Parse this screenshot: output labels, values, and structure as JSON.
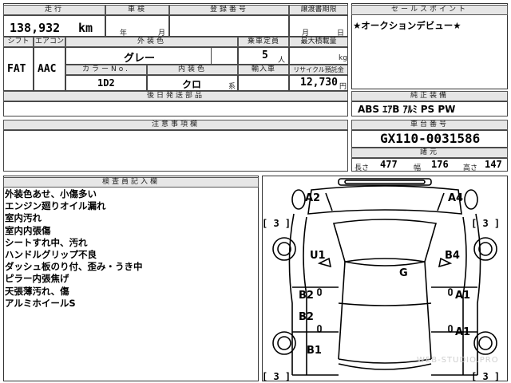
{
  "top_table": {
    "mileage_label": "走行",
    "mileage_value": "138,932",
    "mileage_unit": "km",
    "inspection_label": "車検",
    "inspection_year_unit": "年",
    "inspection_month_unit": "月",
    "reg_label": "登録番号",
    "transfer_label": "譲渡書期限",
    "transfer_month_unit": "月",
    "transfer_day_unit": "日",
    "shift_label": "シフト",
    "shift_value": "FAT",
    "ac_label": "エアコン",
    "ac_value": "AAC",
    "exterior_color_label": "外装色",
    "exterior_color_value": "グレー",
    "color_no_label": "カラーNo.",
    "color_no_value": "1D2",
    "interior_color_label": "内装色",
    "interior_color_value": "クロ",
    "interior_suffix": "系",
    "capacity_label": "乗車定員",
    "capacity_value": "5",
    "capacity_unit": "人",
    "max_load_label": "最大積載量",
    "max_load_unit": "kg",
    "import_label": "輸入車",
    "recycle_label": "リサイクル預託金",
    "recycle_value": "12,730",
    "recycle_unit": "円",
    "aftermarket_label": "後日発送部品"
  },
  "sales_point": {
    "label": "セールスポイント",
    "text": "★オークションデビュー★"
  },
  "equipment": {
    "label": "純正装備",
    "value": "ABS ｴｱB ｱﾙﾐ PS PW"
  },
  "caution": {
    "label": "注意事項欄"
  },
  "chassis": {
    "label": "車台番号",
    "value": "GX110-0031586",
    "specs_label": "諸元",
    "length_label": "長さ",
    "length_value": "477",
    "width_label": "幅",
    "width_value": "176",
    "height_label": "高さ",
    "height_value": "147"
  },
  "inspector": {
    "label": "検査員記入欄",
    "notes": [
      "外装色あせ、小傷多い",
      "エンジン廻りオイル漏れ",
      "室内汚れ",
      "室内内張傷",
      "シートすれ中、汚れ",
      "ハンドルグリップ不良",
      "ダッシュ板のり付、歪み・うき中",
      "ピラー内張焦げ",
      "天張薄汚れ、傷",
      "アルミホイールS"
    ]
  },
  "diagram": {
    "grades": {
      "front_left": "A2",
      "front_right": "A4",
      "left_front_fender": "U1",
      "right_front_fender": "B4",
      "roof": "G",
      "left_front_door": "B2",
      "right_front_door": "A1",
      "left_rear_door": "B2",
      "right_rear_door": "A1",
      "left_rear": "B1"
    },
    "tire_ratings": [
      "[ 3 ]",
      "[ 3 ]",
      "[ 3 ]",
      "[ 3 ]"
    ]
  },
  "watermark": "WEB-STUDIO.PRO"
}
